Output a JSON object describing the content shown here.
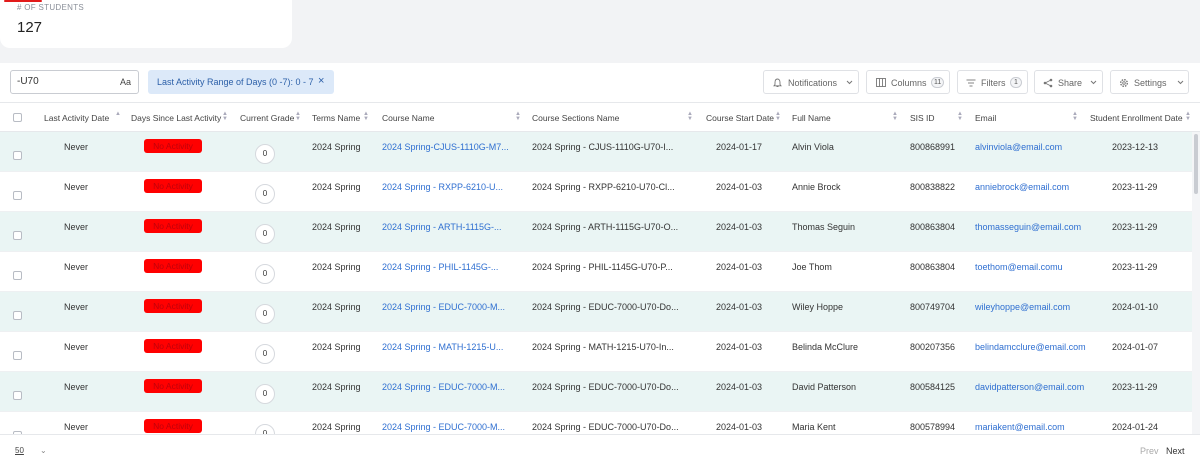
{
  "stat": {
    "label": "# OF STUDENTS",
    "value": "127",
    "accent_color": "#e21b1b"
  },
  "toolbar": {
    "search_value": "-U70",
    "case_toggle": "Aa",
    "filter_chip": "Last Activity Range of Days (0 -7): 0 - 7",
    "filter_chip_close": "×",
    "notifications": "Notifications",
    "columns": "Columns",
    "columns_count": "11",
    "filters": "Filters",
    "filters_count": "1",
    "share": "Share",
    "settings": "Settings"
  },
  "columns": [
    "Last Activity Date",
    "Days Since Last Activity",
    "Current Grade",
    "Terms Name",
    "Course Name",
    "Course Sections Name",
    "Course Start Date",
    "Full Name",
    "SIS ID",
    "Email",
    "Student Enrollment Date"
  ],
  "no_activity_label": "No Activity",
  "no_activity_color": "#ff0000",
  "rows": [
    {
      "last_activity": "Never",
      "grade": "0",
      "term": "2024 Spring",
      "course": "2024 Spring-CJUS-1110G-M7...",
      "section": "2024 Spring - CJUS-1110G-U70-I...",
      "start": "2024-01-17",
      "name": "Alvin Viola",
      "sis": "800868991",
      "email": "alvinviola@email.com",
      "enroll": "2023-12-13"
    },
    {
      "last_activity": "Never",
      "grade": "0",
      "term": "2024 Spring",
      "course": "2024 Spring - RXPP-6210-U...",
      "section": "2024 Spring - RXPP-6210-U70-Cl...",
      "start": "2024-01-03",
      "name": "Annie Brock",
      "sis": "800838822",
      "email": "anniebrock@email.com",
      "enroll": "2023-11-29"
    },
    {
      "last_activity": "Never",
      "grade": "0",
      "term": "2024 Spring",
      "course": "2024 Spring - ARTH-1115G-...",
      "section": "2024 Spring - ARTH-1115G-U70-O...",
      "start": "2024-01-03",
      "name": "Thomas Seguin",
      "sis": "800863804",
      "email": "thomasseguin@email.com",
      "enroll": "2023-11-29"
    },
    {
      "last_activity": "Never",
      "grade": "0",
      "term": "2024 Spring",
      "course": "2024 Spring - PHIL-1145G-...",
      "section": "2024 Spring - PHIL-1145G-U70-P...",
      "start": "2024-01-03",
      "name": "Joe Thom",
      "sis": "800863804",
      "email": "toethom@email.comu",
      "enroll": "2023-11-29"
    },
    {
      "last_activity": "Never",
      "grade": "0",
      "term": "2024 Spring",
      "course": "2024 Spring - EDUC-7000-M...",
      "section": "2024 Spring - EDUC-7000-U70-Do...",
      "start": "2024-01-03",
      "name": "Wiley Hoppe",
      "sis": "800749704",
      "email": "wileyhoppe@email.com",
      "enroll": "2024-01-10"
    },
    {
      "last_activity": "Never",
      "grade": "0",
      "term": "2024 Spring",
      "course": "2024 Spring - MATH-1215-U...",
      "section": "2024 Spring - MATH-1215-U70-In...",
      "start": "2024-01-03",
      "name": "Belinda McClure",
      "sis": "800207356",
      "email": "belindamcclure@email.com",
      "enroll": "2024-01-07"
    },
    {
      "last_activity": "Never",
      "grade": "0",
      "term": "2024 Spring",
      "course": "2024 Spring - EDUC-7000-M...",
      "section": "2024 Spring - EDUC-7000-U70-Do...",
      "start": "2024-01-03",
      "name": "David Patterson",
      "sis": "800584125",
      "email": "davidpatterson@email.com",
      "enroll": "2023-11-29"
    },
    {
      "last_activity": "Never",
      "grade": "0",
      "term": "2024 Spring",
      "course": "2024 Spring - EDUC-7000-M...",
      "section": "2024 Spring - EDUC-7000-U70-Do...",
      "start": "2024-01-03",
      "name": "Maria Kent",
      "sis": "800578994",
      "email": "mariakent@email.com",
      "enroll": "2024-01-24"
    }
  ],
  "footer": {
    "page_size": "50",
    "prev": "Prev",
    "next": "Next"
  }
}
